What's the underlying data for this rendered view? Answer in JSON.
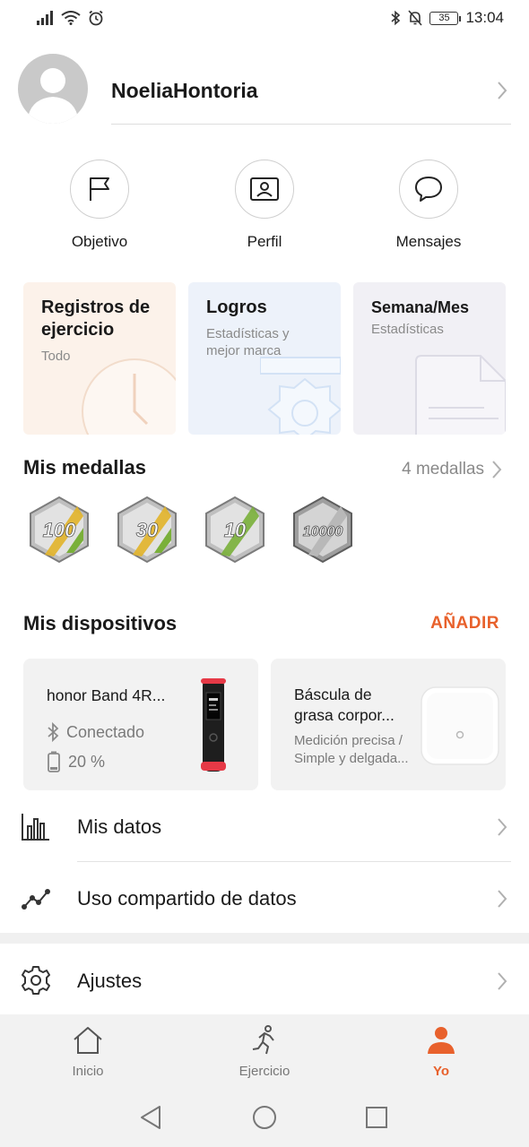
{
  "statusbar": {
    "time": "13:04",
    "battery": "35",
    "icons": [
      "signal-icon",
      "wifi-icon",
      "alarm-icon",
      "bluetooth-icon",
      "mute-icon",
      "battery-icon"
    ]
  },
  "profile": {
    "name": "NoeliaHontoria"
  },
  "quick_actions": [
    {
      "label": "Objetivo",
      "icon": "flag-icon"
    },
    {
      "label": "Perfil",
      "icon": "id-card-icon"
    },
    {
      "label": "Mensajes",
      "icon": "chat-bubble-icon"
    }
  ],
  "cards": {
    "records": {
      "title_line1": "Registros de",
      "title_line2": "ejercicio",
      "subtitle": "Todo"
    },
    "achievements": {
      "title": "Logros",
      "subtitle_line1": "Estadísticas y",
      "subtitle_line2": "mejor marca"
    },
    "weekmonth": {
      "title": "Semana/Mes",
      "subtitle": "Estadísticas"
    }
  },
  "medals": {
    "title": "Mis medallas",
    "count_label": "4 medallas",
    "items": [
      "100",
      "30",
      "10",
      "10000"
    ]
  },
  "devices": {
    "title": "Mis dispositivos",
    "add_label": "AÑADIR",
    "band": {
      "name": "honor Band 4R...",
      "status": "Conectado",
      "battery": "20 %"
    },
    "scale": {
      "name_line1": "Báscula de",
      "name_line2": "grasa corpor...",
      "desc_line1": "Medición precisa /",
      "desc_line2": "Simple y delgada..."
    }
  },
  "menu": {
    "my_data": "Mis datos",
    "data_sharing": "Uso compartido de datos",
    "settings": "Ajustes"
  },
  "bottom_nav": {
    "home": "Inicio",
    "exercise": "Ejercicio",
    "me": "Yo"
  },
  "colors": {
    "accent": "#e8612c",
    "medal_stripe_gold": "#e2b42a",
    "medal_stripe_green": "#7ab03a"
  }
}
